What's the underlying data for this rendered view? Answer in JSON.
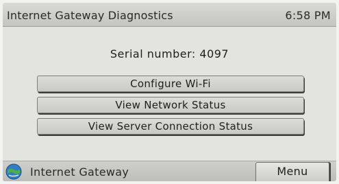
{
  "title_bar": {
    "title": "Internet Gateway Diagnostics",
    "time": "6:58 PM"
  },
  "main": {
    "serial_label": "Serial number: 4097",
    "buttons": [
      {
        "label": "Configure Wi-Fi"
      },
      {
        "label": "View Network Status"
      },
      {
        "label": "View Server Connection Status"
      }
    ]
  },
  "bottom_bar": {
    "icon": "gateway-icon",
    "label": "Internet Gateway",
    "menu_label": "Menu"
  },
  "colors": {
    "background": "#e1e1dd",
    "title_bar": "#cfcfcb",
    "button_face": "#d3d3cf",
    "button_shadow": "#3c3c3a",
    "icon_blue": "#2f7fc4",
    "icon_green": "#4fae4a"
  }
}
